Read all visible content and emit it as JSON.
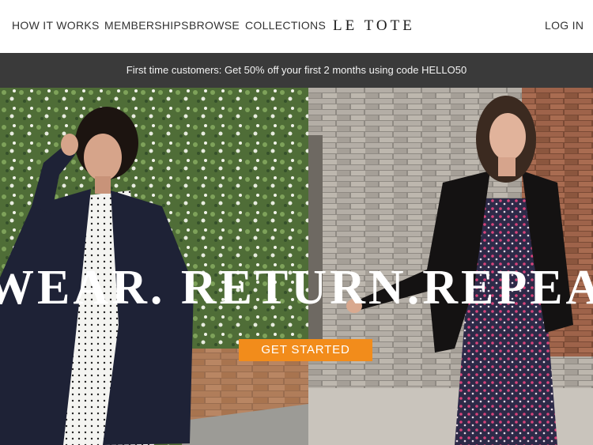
{
  "nav": {
    "items": [
      "HOW IT WORKS",
      "MEMBERSHIPS",
      "BROWSE",
      "COLLECTIONS"
    ],
    "logo": "LE TOTE",
    "login": "LOG IN"
  },
  "promo": {
    "text": "First time customers: Get 50% off your first 2 months using code HELLO50"
  },
  "hero": {
    "headline": "WEAR. RETURN.REPEAT",
    "cta": "GET STARTED"
  },
  "colors": {
    "promo_bg": "#3a3a3a",
    "cta_bg": "#f28c1b",
    "nav_text": "#333333"
  }
}
